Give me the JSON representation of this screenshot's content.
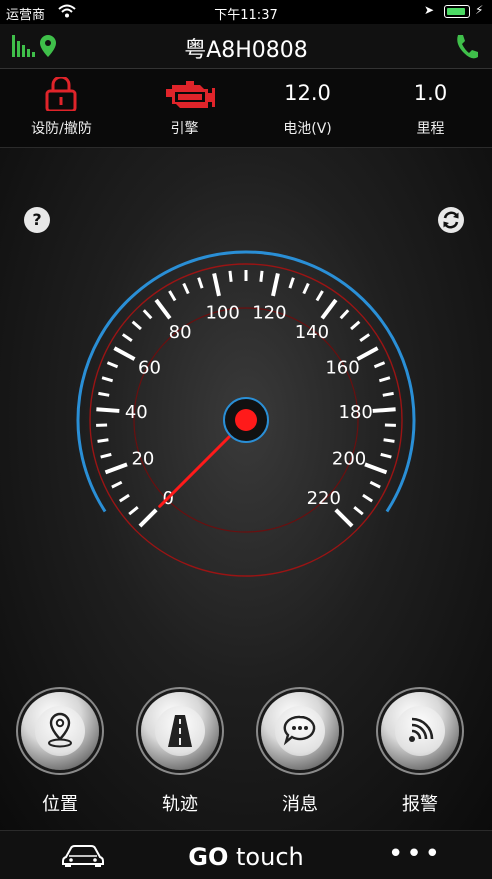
{
  "status_bar": {
    "carrier": "运营商",
    "time": "下午11:37",
    "battery_level": 0.9
  },
  "nav": {
    "title": "粤A8H0808"
  },
  "info_bar": {
    "lock_label": "设防/撤防",
    "engine_label": "引擎",
    "battery_value": "12.0",
    "battery_label": "电池(V)",
    "mileage_value": "1.0",
    "mileage_label": "里程"
  },
  "speedometer": {
    "ticks": [
      "0",
      "20",
      "40",
      "60",
      "80",
      "100",
      "120",
      "140",
      "160",
      "180",
      "200",
      "220"
    ],
    "min": 0,
    "max": 220,
    "value": 0,
    "needle_color": "#ff1a1a",
    "arc_color": "#2a8fd6"
  },
  "actions": [
    {
      "label": "位置",
      "icon": "location-pin-icon"
    },
    {
      "label": "轨迹",
      "icon": "road-track-icon"
    },
    {
      "label": "消息",
      "icon": "message-bubble-icon"
    },
    {
      "label": "报警",
      "icon": "alarm-signal-icon"
    }
  ],
  "tab_bar": {
    "brand_bold": "GO",
    "brand_light": "touch",
    "more": "•••"
  },
  "colors": {
    "accent_green": "#3fbf4a",
    "alert_red": "#e0242a"
  }
}
